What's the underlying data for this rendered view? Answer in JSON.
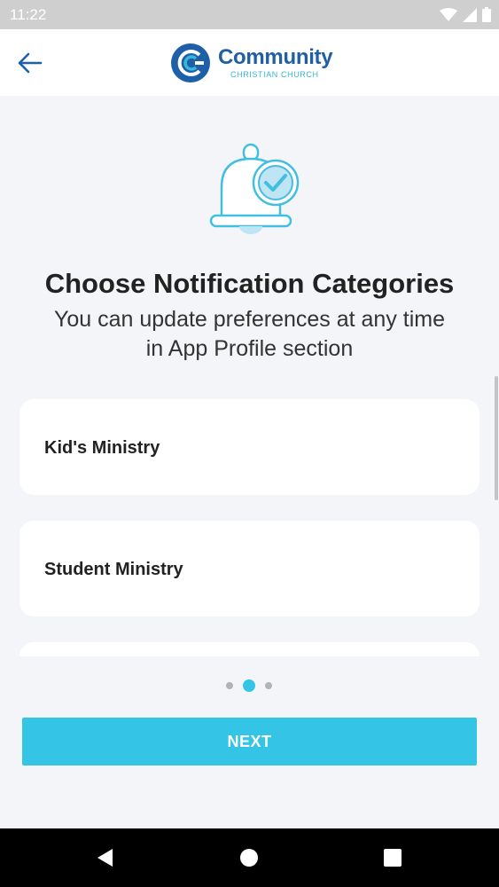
{
  "status_bar": {
    "time": "11:22",
    "icons": [
      "wifi-icon",
      "cell-signal-icon",
      "battery-icon"
    ]
  },
  "app_bar": {
    "back_icon": "arrow-left-icon",
    "logo": {
      "title": "Community",
      "subtitle": "CHRISTIAN CHURCH"
    }
  },
  "onboarding": {
    "illustration": "bell-check-icon",
    "title": "Choose Notification Categories",
    "subtitle": "You can update preferences at any time in App Profile section",
    "categories": [
      {
        "label": "Kid's Ministry"
      },
      {
        "label": "Student Ministry"
      },
      {
        "label": ""
      }
    ]
  },
  "pager": {
    "total": 3,
    "active": 2
  },
  "actions": {
    "next_label": "NEXT"
  },
  "colors": {
    "accent": "#34c5e6",
    "brand_blue": "#1f5fa8",
    "background": "#f4f5f9",
    "card": "#ffffff",
    "dot_inactive": "#b3b3b3"
  },
  "system_nav": {
    "buttons": [
      "back-triangle-icon",
      "home-circle-icon",
      "recents-square-icon"
    ]
  }
}
